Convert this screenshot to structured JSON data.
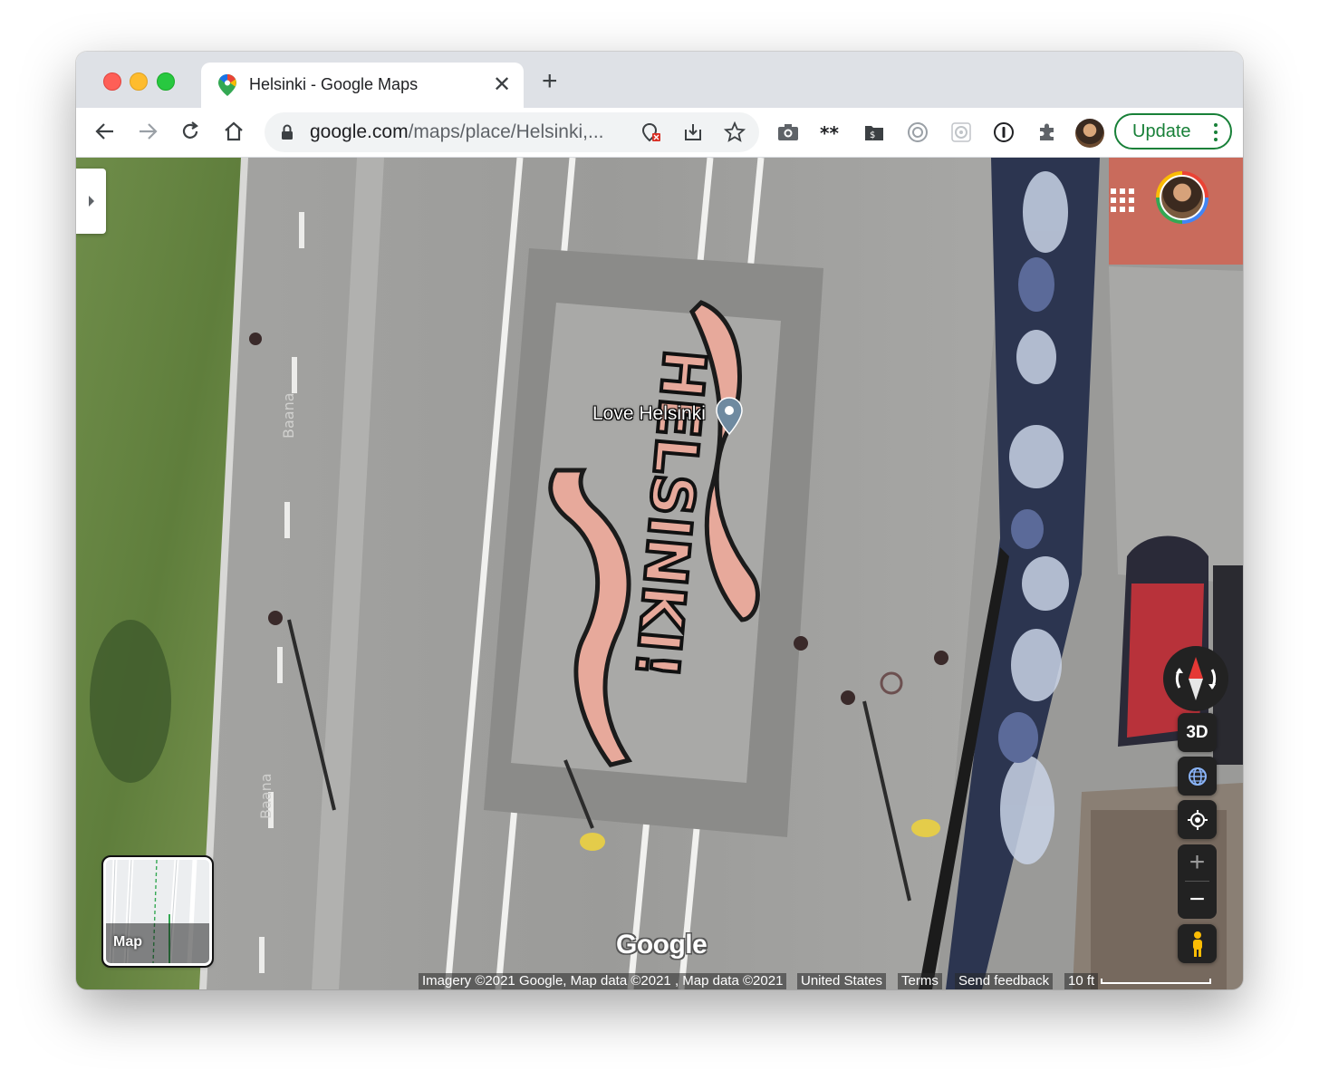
{
  "browser": {
    "tab": {
      "title": "Helsinki - Google Maps",
      "close_glyph": "✕"
    },
    "new_tab_glyph": "+",
    "omnibox": {
      "domain": "google.com",
      "path": "/maps/place/Helsinki,..."
    },
    "update_button": {
      "label": "Update"
    }
  },
  "map": {
    "place_label": "Love Helsinki",
    "controls": {
      "three_d": "3D",
      "zoom_in": "+",
      "zoom_out": "−"
    },
    "minimap_label": "Map",
    "logo": "Google",
    "attribution": {
      "imagery": "Imagery ©2021 Google, Map data ©2021 , Map data ©2021",
      "country": "United States",
      "terms": "Terms",
      "feedback": "Send feedback",
      "scale": "10 ft"
    },
    "road_labels": [
      "Baana",
      "Baana"
    ],
    "street_art_text": "HELSINKI!"
  },
  "colors": {
    "accent_green": "#188038",
    "tab_bar": "#dee1e6",
    "map_bg": "#9a9a98"
  }
}
